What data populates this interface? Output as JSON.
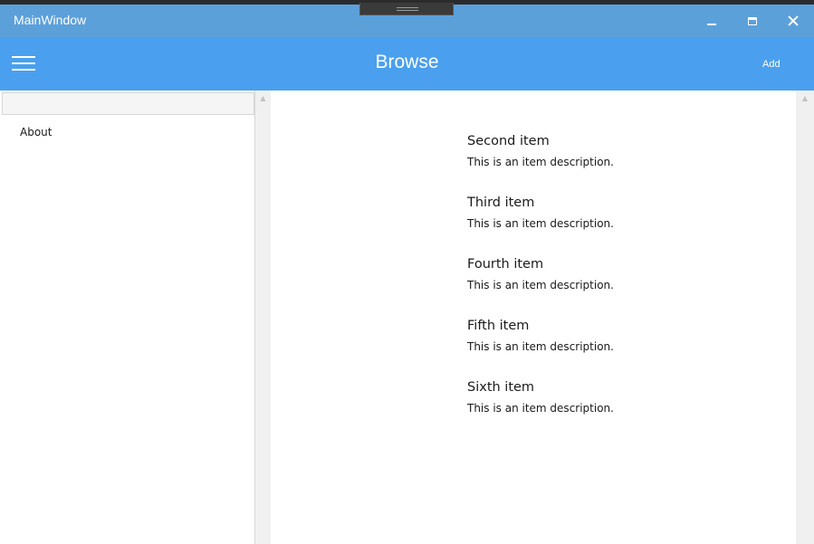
{
  "window": {
    "title": "MainWindow",
    "controls": [
      "minimize",
      "maximize",
      "close"
    ]
  },
  "appbar": {
    "title": "Browse",
    "add_label": "Add"
  },
  "sidebar": {
    "search_value": "",
    "items": [
      {
        "label": "About"
      }
    ]
  },
  "items": [
    {
      "title": "Second item",
      "description": "This is an item description."
    },
    {
      "title": "Third item",
      "description": "This is an item description."
    },
    {
      "title": "Fourth item",
      "description": "This is an item description."
    },
    {
      "title": "Fifth item",
      "description": "This is an item description."
    },
    {
      "title": "Sixth item",
      "description": "This is an item description."
    }
  ],
  "colors": {
    "titlebar": "#5ca0da",
    "appbar": "#4aa0ee"
  }
}
